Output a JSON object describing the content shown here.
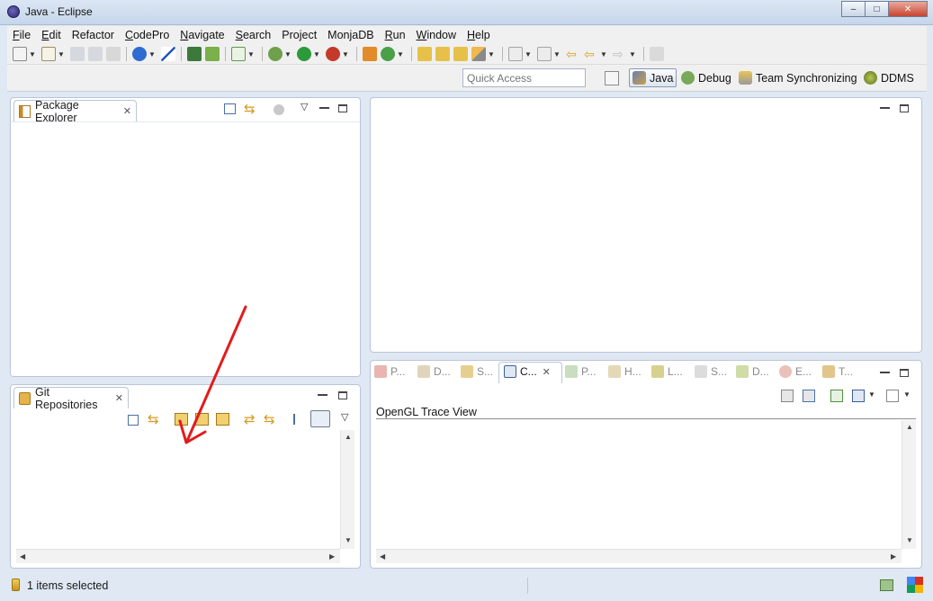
{
  "window": {
    "title": "Java - Eclipse",
    "minimize": "–",
    "maximize": "□",
    "close": "✕"
  },
  "menu": [
    {
      "first": "F",
      "rest": "ile"
    },
    {
      "first": "E",
      "rest": "dit"
    },
    {
      "first": "",
      "rest": "Refactor"
    },
    {
      "first": "C",
      "rest": "odePro"
    },
    {
      "first": "N",
      "rest": "avigate"
    },
    {
      "first": "S",
      "rest": "earch"
    },
    {
      "first": "",
      "rest": "Project"
    },
    {
      "first": "",
      "rest": "MonjaDB"
    },
    {
      "first": "R",
      "rest": "un"
    },
    {
      "first": "W",
      "rest": "indow"
    },
    {
      "first": "H",
      "rest": "elp"
    }
  ],
  "quick_access": {
    "placeholder": "Quick Access"
  },
  "perspectives": {
    "java": "Java",
    "debug": "Debug",
    "team": "Team Synchronizing",
    "ddms": "DDMS"
  },
  "package_explorer": {
    "tab_label": "Package Explorer",
    "close": "✕"
  },
  "git_repositories": {
    "tab_label": "Git Repositories",
    "close": "✕"
  },
  "bottom_views": {
    "tabs": [
      "P...",
      "D...",
      "S...",
      "C...",
      "P...",
      "H...",
      "L...",
      "S...",
      "D...",
      "E...",
      "T..."
    ],
    "close": "✕",
    "content_title": "OpenGL Trace View"
  },
  "status": {
    "text": "1 items selected"
  },
  "colors": {
    "annotation_arrow": "#e31b1b",
    "panel_border": "#b9c6d8"
  }
}
